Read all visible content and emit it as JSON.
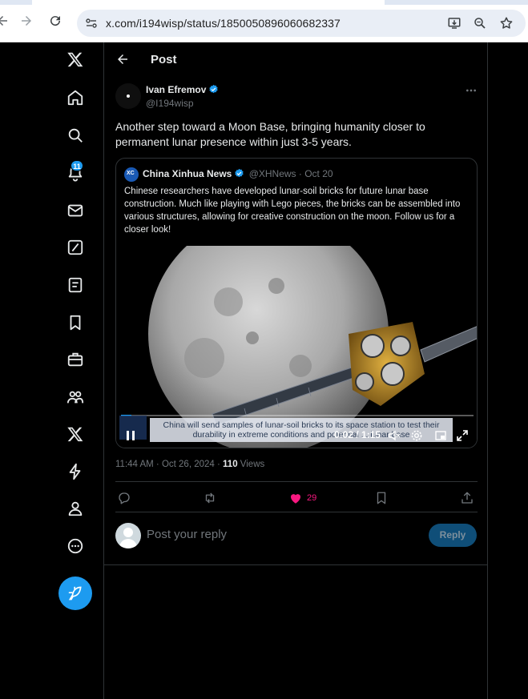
{
  "browser": {
    "url": "x.com/i194wisp/status/1850050896060682337",
    "icons": [
      "back-arrow-icon",
      "forward-arrow-icon",
      "reload-icon",
      "site-settings-icon",
      "install-app-icon",
      "zoom-icon",
      "bookmark-star-icon"
    ]
  },
  "sidebar": {
    "items": [
      {
        "name": "x-logo-icon"
      },
      {
        "name": "home-icon"
      },
      {
        "name": "explore-icon"
      },
      {
        "name": "notifications-icon"
      },
      {
        "name": "messages-icon"
      },
      {
        "name": "grok-icon"
      },
      {
        "name": "lists-icon"
      },
      {
        "name": "bookmarks-icon"
      },
      {
        "name": "jobs-icon"
      },
      {
        "name": "communities-icon"
      },
      {
        "name": "premium-icon"
      },
      {
        "name": "verified-orgs-icon"
      },
      {
        "name": "profile-icon"
      },
      {
        "name": "more-icon"
      }
    ],
    "notification_count": "11"
  },
  "header": {
    "title": "Post"
  },
  "post": {
    "author_name": "Ivan Efremov",
    "author_handle": "@I194wisp",
    "text": "Another step toward a Moon Base, bringing humanity closer to permanent lunar presence within just 3-5 years.",
    "time": "11:44 AM · Oct 26, 2024 · ",
    "views_count": "110",
    "views_label": " Views",
    "like_count": "29"
  },
  "quote": {
    "avatar_text": "XC",
    "author_name": "China Xinhua News",
    "author_meta": "@XHNews · Oct 20",
    "text": "Chinese researchers have developed lunar-soil bricks for future lunar base construction. Much like playing with Lego pieces, the bricks can be assembled into various structures, allowing for creative construction on the moon. Follow us for a closer look!",
    "video": {
      "subtitle": "China will send samples of lunar-soil bricks to its space station to test their durability in extreme conditions and potential ... lunar base",
      "time": "0:02 / 1:15",
      "progress": 0.03
    }
  },
  "reply": {
    "placeholder": "Post your reply",
    "button_label": "Reply"
  },
  "colors": {
    "accent": "#1d9bf0",
    "like": "#f91880",
    "background": "#000000"
  }
}
